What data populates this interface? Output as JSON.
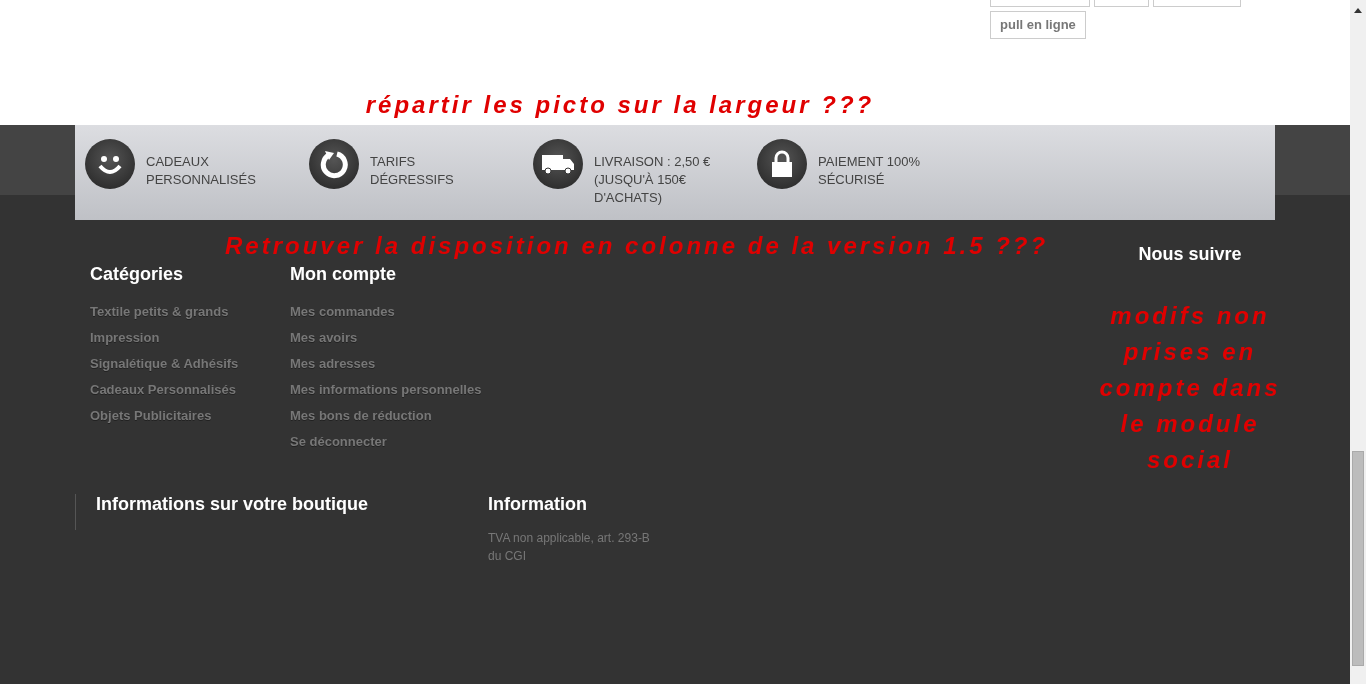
{
  "tags": [
    {
      "label": "pull en ligne"
    }
  ],
  "annotations": {
    "picto": "répartir les picto sur la largeur ???",
    "columns": "Retrouver la disposition en colonne de la version 1.5 ???",
    "social": "modifs non prises en compte dans le module social"
  },
  "reassurance": [
    {
      "kind": "smile",
      "lines": [
        "CADEAUX",
        "PERSONNALISÉS"
      ]
    },
    {
      "kind": "refresh",
      "lines": [
        "TARIFS",
        "DÉGRESSIFS"
      ]
    },
    {
      "kind": "truck",
      "lines": [
        "LIVRAISON : 2,50 €",
        "(JUSQU'À 150€",
        "D'ACHATS)"
      ]
    },
    {
      "kind": "lock",
      "lines": [
        "PAIEMENT 100%",
        "SÉCURISÉ"
      ]
    }
  ],
  "categories": {
    "title": "Catégories",
    "links": [
      "Textile petits & grands",
      "Impression",
      "Signalétique & Adhésifs",
      "Cadeaux Personnalisés",
      "Objets Publicitaires"
    ]
  },
  "account": {
    "title": "Mon compte",
    "links": [
      "Mes commandes",
      "Mes avoirs",
      "Mes adresses",
      "Mes informations personnelles",
      "Mes bons de réduction",
      "Se déconnecter"
    ]
  },
  "social": {
    "title": "Nous suivre"
  },
  "shop_info": {
    "title": "Informations sur votre boutique"
  },
  "information": {
    "title": "Information",
    "text": "TVA non applicable, art. 293-B du CGI"
  }
}
